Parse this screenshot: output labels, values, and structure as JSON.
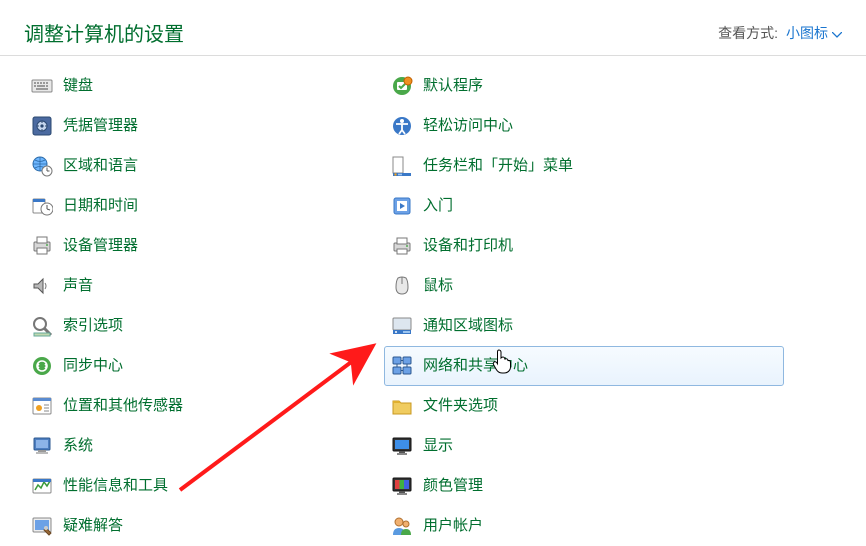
{
  "header": {
    "title": "调整计算机的设置",
    "view_label": "查看方式:",
    "view_value": "小图标"
  },
  "columns": {
    "left": [
      {
        "label": "键盘",
        "icon": "keyboard-icon"
      },
      {
        "label": "凭据管理器",
        "icon": "credential-manager-icon"
      },
      {
        "label": "区域和语言",
        "icon": "region-language-icon"
      },
      {
        "label": "日期和时间",
        "icon": "date-time-icon"
      },
      {
        "label": "设备管理器",
        "icon": "device-manager-icon"
      },
      {
        "label": "声音",
        "icon": "sound-icon"
      },
      {
        "label": "索引选项",
        "icon": "indexing-options-icon"
      },
      {
        "label": "同步中心",
        "icon": "sync-center-icon"
      },
      {
        "label": "位置和其他传感器",
        "icon": "location-sensors-icon"
      },
      {
        "label": "系统",
        "icon": "system-icon"
      },
      {
        "label": "性能信息和工具",
        "icon": "performance-tools-icon"
      },
      {
        "label": "疑难解答",
        "icon": "troubleshooting-icon"
      }
    ],
    "right": [
      {
        "label": "默认程序",
        "icon": "default-programs-icon"
      },
      {
        "label": "轻松访问中心",
        "icon": "ease-of-access-icon"
      },
      {
        "label": "任务栏和「开始」菜单",
        "icon": "taskbar-startmenu-icon"
      },
      {
        "label": "入门",
        "icon": "getting-started-icon"
      },
      {
        "label": "设备和打印机",
        "icon": "devices-printers-icon"
      },
      {
        "label": "鼠标",
        "icon": "mouse-icon"
      },
      {
        "label": "通知区域图标",
        "icon": "notification-area-icon"
      },
      {
        "label": "网络和共享中心",
        "icon": "network-sharing-icon",
        "highlighted": true
      },
      {
        "label": "文件夹选项",
        "icon": "folder-options-icon"
      },
      {
        "label": "显示",
        "icon": "display-icon"
      },
      {
        "label": "颜色管理",
        "icon": "color-management-icon"
      },
      {
        "label": "用户帐户",
        "icon": "user-accounts-icon"
      }
    ]
  }
}
